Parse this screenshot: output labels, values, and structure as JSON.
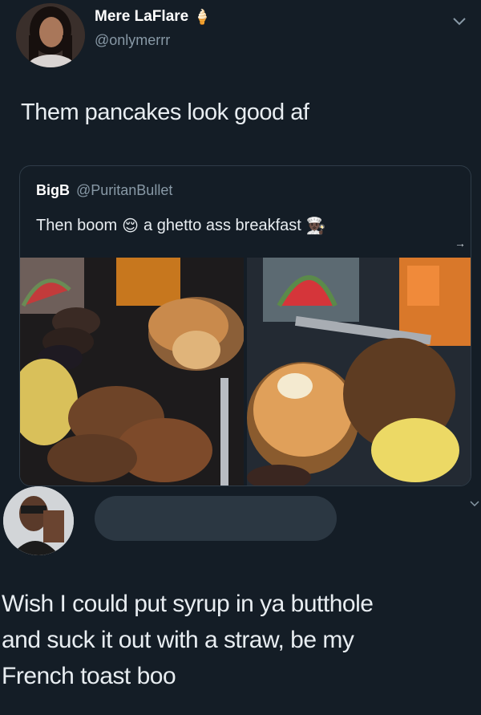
{
  "tweet": {
    "display_name": "Mere LaFlare",
    "name_emoji": "🍦",
    "handle": "@onlymerrr",
    "text": "Them pancakes look good af"
  },
  "quote": {
    "display_name": "BigB",
    "handle": "@PuritanBullet",
    "text_part1": "Then boom",
    "emoji1": "😌",
    "text_part2": "a ghetto ass breakfast",
    "emoji2": "👨🏿‍🍳",
    "arrow": "→"
  },
  "reply": {
    "text_line1": "Wish I could put syrup in ya butthole",
    "text_line2": "and suck it out with a straw, be my",
    "text_line3": "French toast boo"
  },
  "icons": [
    "chevron-down-icon",
    "icecream-emoji-icon",
    "relieved-emoji-icon",
    "cook-emoji-icon"
  ]
}
